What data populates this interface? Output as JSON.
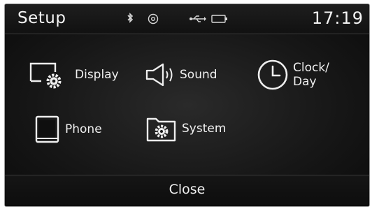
{
  "header": {
    "title": "Setup",
    "time": "17:19",
    "status_icons": [
      "bluetooth-icon",
      "gps-icon",
      "usb-icon",
      "battery-icon"
    ]
  },
  "menu": {
    "items": [
      {
        "label": "Display",
        "icon": "display-settings-icon"
      },
      {
        "label": "Sound",
        "icon": "speaker-icon"
      },
      {
        "label": "Clock/\nDay",
        "icon": "clock-icon"
      },
      {
        "label": "Phone",
        "icon": "phone-icon"
      },
      {
        "label": "System",
        "icon": "folder-gear-icon"
      }
    ]
  },
  "footer": {
    "close_label": "Close"
  }
}
